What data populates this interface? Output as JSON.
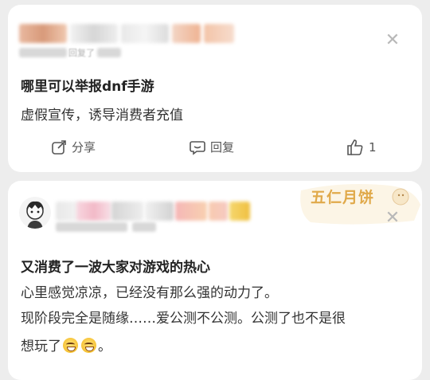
{
  "comments": [
    {
      "username_hidden": true,
      "meta_text": "回复了",
      "title": "哪里可以举报dnf手游",
      "lines": [
        "虚假宣传，诱导消费者充值"
      ],
      "actions": {
        "share_label": "分享",
        "reply_label": "回复",
        "like_count": "1"
      }
    },
    {
      "username_hidden": true,
      "sticker_text": "五仁月饼",
      "title": "又消费了一波大家对游戏的热心",
      "lines": [
        "心里感觉凉凉，已经没有那么强的动力了。",
        "现阶段完全是随缘……爱公测不公测。公测了也不是很",
        "想玩了"
      ],
      "trailing_punct": "。"
    }
  ],
  "colors": {
    "background": "#ededed",
    "card": "#ffffff",
    "title_text": "#222222",
    "body_text": "#333333",
    "muted_icon": "#b8b8b8"
  },
  "icons": [
    "close-icon",
    "share-icon",
    "reply-icon",
    "like-icon",
    "grin-emoji"
  ]
}
